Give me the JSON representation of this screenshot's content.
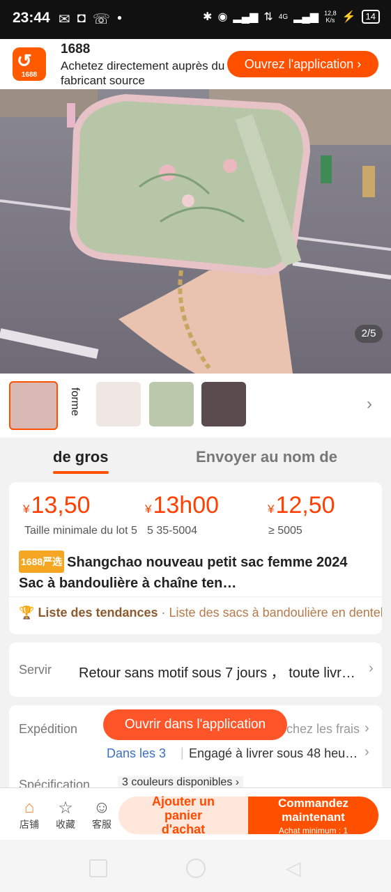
{
  "status_bar": {
    "time": "23:44",
    "left_icons": [
      "gmail-icon",
      "instagram-icon",
      "whatsapp-icon",
      "dot-icon"
    ],
    "net_speed": "12,8\nK/s",
    "network": "4G",
    "battery": "14"
  },
  "app_banner": {
    "logo_text": "1688",
    "title": "1688",
    "subtitle": "Achetez directement auprès du fabricant source",
    "open_button": "Ouvrez l'application"
  },
  "gallery": {
    "counter": "2/5"
  },
  "variant_strip": {
    "label": "forme"
  },
  "tabs": [
    {
      "label": "de gros",
      "active": true
    },
    {
      "label": "Envoyer au nom de",
      "active": false
    }
  ],
  "pricing": {
    "currency": "¥",
    "tiers": [
      {
        "price": "13,50",
        "condition": "Taille minimale du lot 5"
      },
      {
        "price": "13h00",
        "condition": "5 35-5004"
      },
      {
        "price": "12,50",
        "condition": "≥ 5005"
      }
    ],
    "badge": "1688严选",
    "title": "Shangchao nouveau petit sac femme 2024 Sac à bandoulière à chaîne ten…",
    "trend_label": "Liste des tendances",
    "trend_sep": "·",
    "trend_text": "Liste des sacs à bandoulière en dentelle"
  },
  "service": {
    "label": "Servir",
    "value": "Retour sans motif sous 7 jours ， toute livr…"
  },
  "shipping": {
    "label": "Expédition",
    "value_hidden": "chez les frais",
    "link": "Dans les 3",
    "separator": "|",
    "detail": "Engagé à livrer sous 48 heu…",
    "float_button": "Ouvrir dans l'application"
  },
  "spec": {
    "label": "Spécification",
    "value": "3 couleurs disponibles"
  },
  "action_bar": {
    "shop": "店铺",
    "favorite": "收藏",
    "service": "客服",
    "cart_button": "Ajouter un panier d'achat",
    "order_button": "Commandez maintenant",
    "order_sub": "Achat minimum : 1"
  },
  "colors": {
    "accent": "#ff5000",
    "badge": "#f5a623",
    "link": "#3a6fc7"
  }
}
